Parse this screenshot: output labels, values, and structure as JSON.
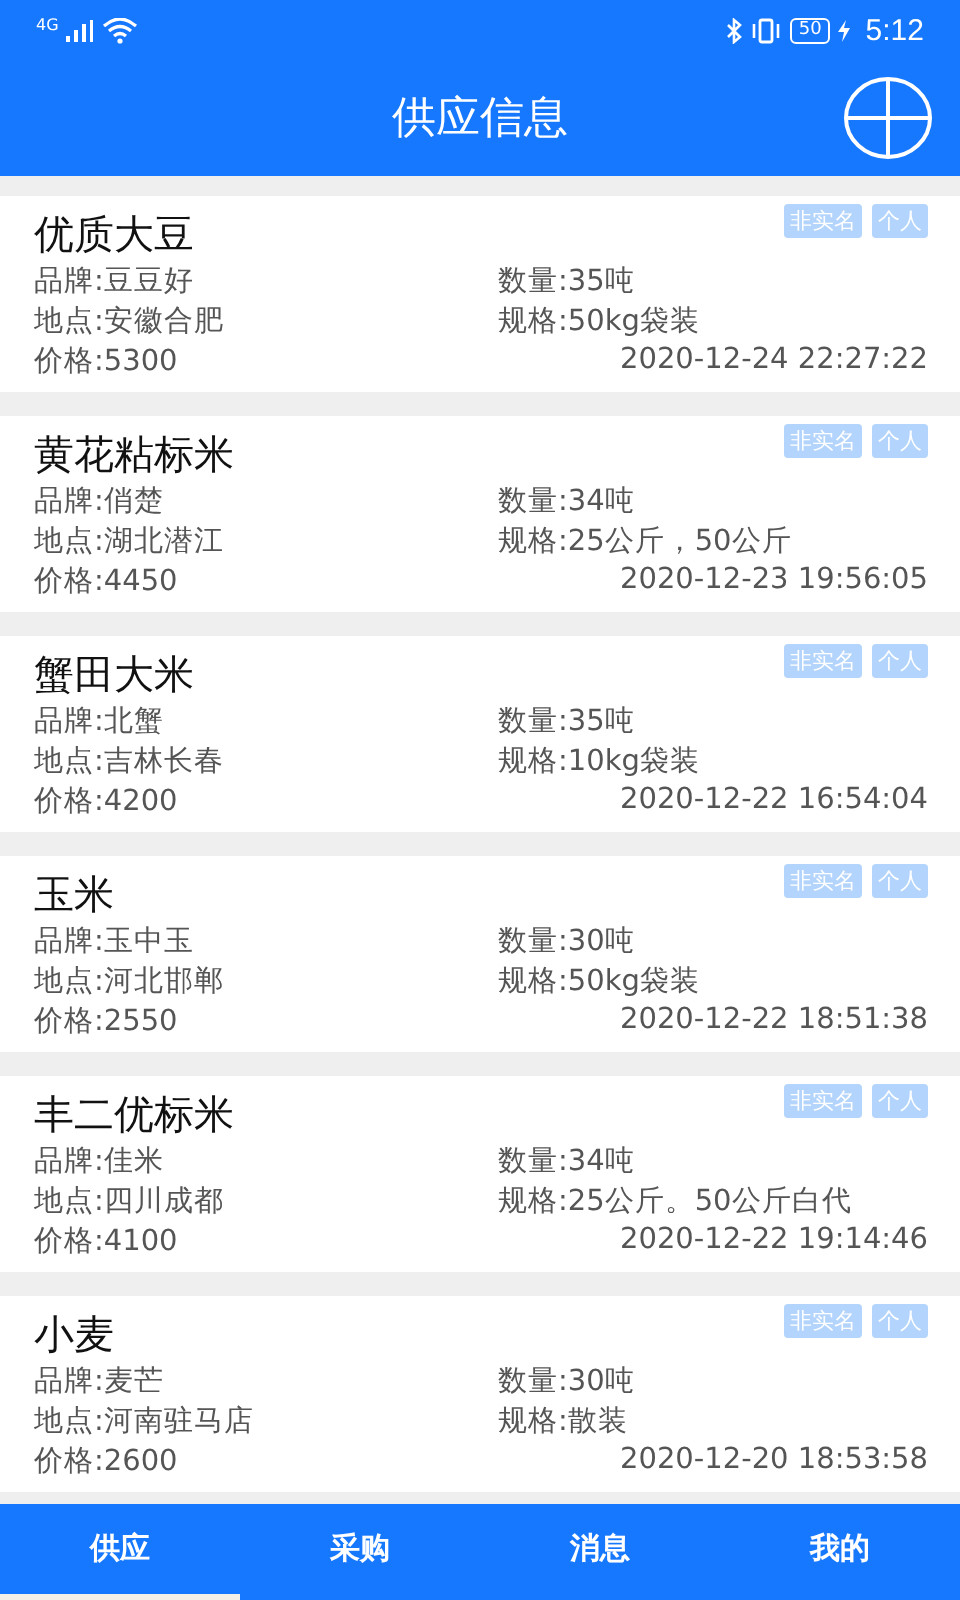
{
  "status_bar": {
    "network": "4G",
    "battery": "50",
    "time": "5:12"
  },
  "header": {
    "title": "供应信息"
  },
  "items": [
    {
      "name": "优质大豆",
      "tags": [
        "非实名",
        "个人"
      ],
      "brand": "品牌:豆豆好",
      "quantity": "数量:35吨",
      "location": "地点:安徽合肥",
      "spec": "规格:50kg袋装",
      "price": "价格:5300",
      "time": "2020-12-24 22:27:22"
    },
    {
      "name": "黄花粘标米",
      "tags": [
        "非实名",
        "个人"
      ],
      "brand": "品牌:俏楚",
      "quantity": "数量:34吨",
      "location": "地点:湖北潜江",
      "spec": "规格:25公斤，50公斤",
      "price": "价格:4450",
      "time": "2020-12-23 19:56:05"
    },
    {
      "name": "蟹田大米",
      "tags": [
        "非实名",
        "个人"
      ],
      "brand": "品牌:北蟹",
      "quantity": "数量:35吨",
      "location": "地点:吉林长春",
      "spec": "规格:10kg袋装",
      "price": "价格:4200",
      "time": "2020-12-22 16:54:04"
    },
    {
      "name": "玉米",
      "tags": [
        "非实名",
        "个人"
      ],
      "brand": "品牌:玉中玉",
      "quantity": "数量:30吨",
      "location": "地点:河北邯郸",
      "spec": "规格:50kg袋装",
      "price": "价格:2550",
      "time": "2020-12-22 18:51:38"
    },
    {
      "name": "丰二优标米",
      "tags": [
        "非实名",
        "个人"
      ],
      "brand": "品牌:佳米",
      "quantity": "数量:34吨",
      "location": "地点:四川成都",
      "spec": "规格:25公斤。50公斤白代",
      "price": "价格:4100",
      "time": "2020-12-22 19:14:46"
    },
    {
      "name": "小麦",
      "tags": [
        "非实名",
        "个人"
      ],
      "brand": "品牌:麦芒",
      "quantity": "数量:30吨",
      "location": "地点:河南驻马店",
      "spec": "规格:散装",
      "price": "价格:2600",
      "time": "2020-12-20 18:53:58"
    }
  ],
  "tabs": [
    {
      "label": "供应",
      "selected": true
    },
    {
      "label": "采购",
      "selected": false
    },
    {
      "label": "消息",
      "selected": false
    },
    {
      "label": "我的",
      "selected": false
    }
  ]
}
